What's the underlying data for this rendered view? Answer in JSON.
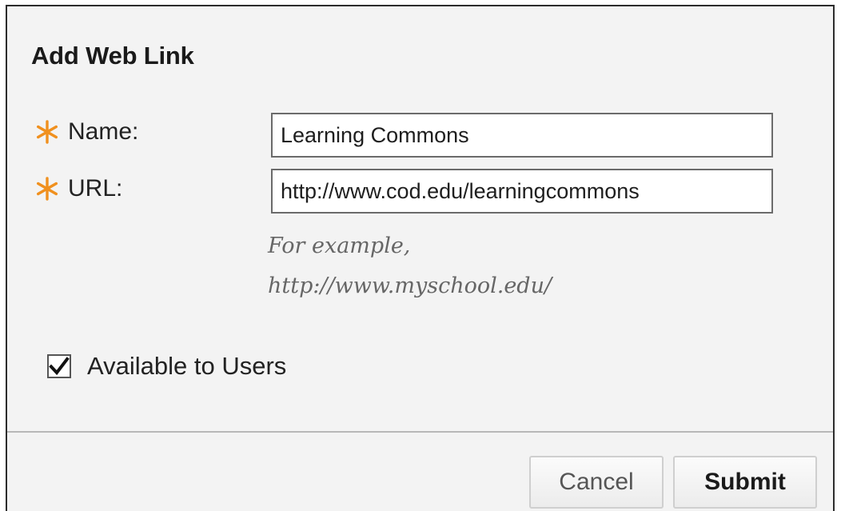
{
  "dialog": {
    "title": "Add Web Link"
  },
  "form": {
    "name": {
      "label": "Name:",
      "value": "Learning Commons",
      "required_icon": "asterisk-icon"
    },
    "url": {
      "label": "URL:",
      "value": "http://www.cod.edu/learningcommons",
      "required_icon": "asterisk-icon",
      "hint_line1": "For example,",
      "hint_line2": "http://www.myschool.edu/"
    },
    "available": {
      "label": "Available to Users",
      "checked": true
    }
  },
  "buttons": {
    "cancel_label": "Cancel",
    "submit_label": "Submit"
  },
  "colors": {
    "required_asterisk": "#f0901e",
    "dialog_background": "#f3f3f3"
  }
}
